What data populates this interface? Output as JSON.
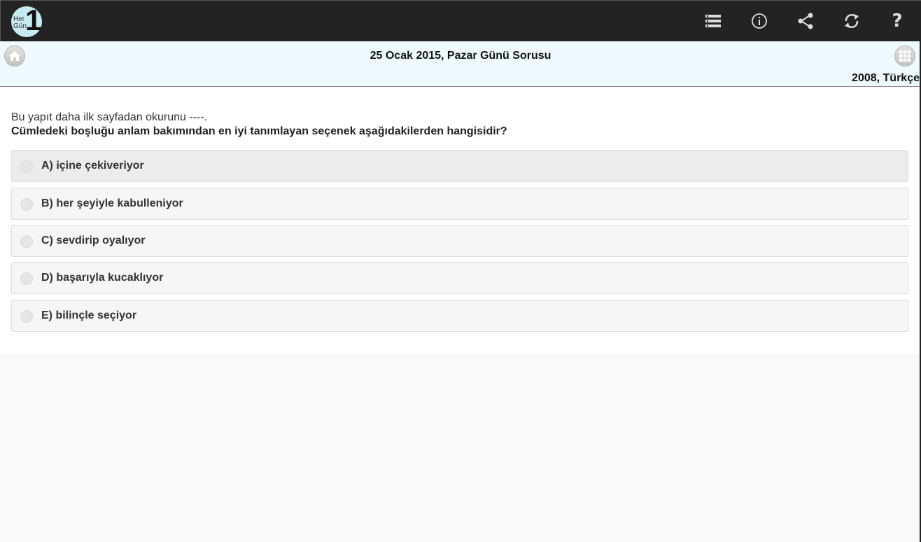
{
  "app": {
    "logo_small_line1": "Her",
    "logo_small_line2": "Gün",
    "logo_big": "1"
  },
  "toolbar": {
    "icons": [
      "list-icon",
      "info-icon",
      "share-icon",
      "refresh-icon",
      "help-icon"
    ],
    "help_glyph": "?"
  },
  "subheader": {
    "title": "25 Ocak 2015, Pazar Günü Sorusu",
    "meta": "2008, Türkçe"
  },
  "question": {
    "text": "Bu yapıt daha ilk sayfadan okurunu ----.",
    "prompt": "Cümledeki boşluğu anlam bakımından en iyi tanımlayan seçenek aşağıdakilerden hangisidir?"
  },
  "options": [
    {
      "label": "A) içine çekiveriyor"
    },
    {
      "label": "B) her şeyiyle kabulleniyor"
    },
    {
      "label": "C) sevdirip oyalıyor"
    },
    {
      "label": "D) başarıyla kucaklıyor"
    },
    {
      "label": "E) bilinçle seçiyor"
    }
  ],
  "colors": {
    "topbar": "#232323",
    "subheader": "#eefafd",
    "logo": "#c6ecf2"
  }
}
